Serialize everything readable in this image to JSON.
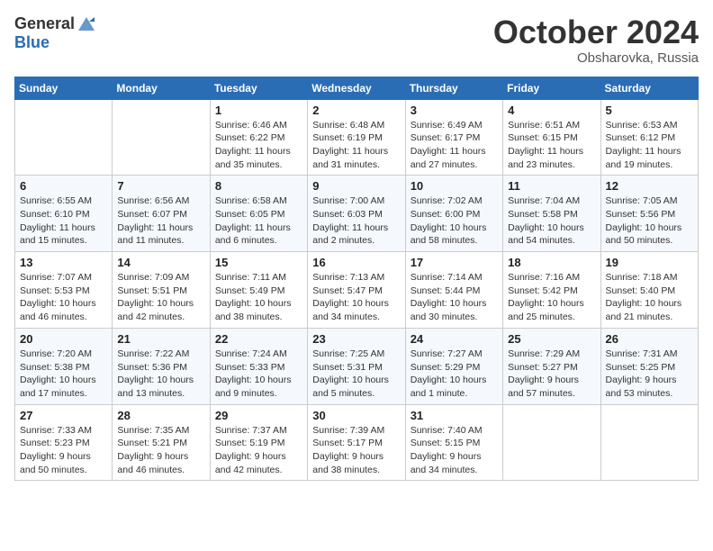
{
  "header": {
    "logo_general": "General",
    "logo_blue": "Blue",
    "month": "October 2024",
    "location": "Obsharovka, Russia"
  },
  "days_of_week": [
    "Sunday",
    "Monday",
    "Tuesday",
    "Wednesday",
    "Thursday",
    "Friday",
    "Saturday"
  ],
  "weeks": [
    [
      null,
      null,
      {
        "day": 1,
        "sunrise": "6:46 AM",
        "sunset": "6:22 PM",
        "daylight": "11 hours and 35 minutes."
      },
      {
        "day": 2,
        "sunrise": "6:48 AM",
        "sunset": "6:19 PM",
        "daylight": "11 hours and 31 minutes."
      },
      {
        "day": 3,
        "sunrise": "6:49 AM",
        "sunset": "6:17 PM",
        "daylight": "11 hours and 27 minutes."
      },
      {
        "day": 4,
        "sunrise": "6:51 AM",
        "sunset": "6:15 PM",
        "daylight": "11 hours and 23 minutes."
      },
      {
        "day": 5,
        "sunrise": "6:53 AM",
        "sunset": "6:12 PM",
        "daylight": "11 hours and 19 minutes."
      }
    ],
    [
      {
        "day": 6,
        "sunrise": "6:55 AM",
        "sunset": "6:10 PM",
        "daylight": "11 hours and 15 minutes."
      },
      {
        "day": 7,
        "sunrise": "6:56 AM",
        "sunset": "6:07 PM",
        "daylight": "11 hours and 11 minutes."
      },
      {
        "day": 8,
        "sunrise": "6:58 AM",
        "sunset": "6:05 PM",
        "daylight": "11 hours and 6 minutes."
      },
      {
        "day": 9,
        "sunrise": "7:00 AM",
        "sunset": "6:03 PM",
        "daylight": "11 hours and 2 minutes."
      },
      {
        "day": 10,
        "sunrise": "7:02 AM",
        "sunset": "6:00 PM",
        "daylight": "10 hours and 58 minutes."
      },
      {
        "day": 11,
        "sunrise": "7:04 AM",
        "sunset": "5:58 PM",
        "daylight": "10 hours and 54 minutes."
      },
      {
        "day": 12,
        "sunrise": "7:05 AM",
        "sunset": "5:56 PM",
        "daylight": "10 hours and 50 minutes."
      }
    ],
    [
      {
        "day": 13,
        "sunrise": "7:07 AM",
        "sunset": "5:53 PM",
        "daylight": "10 hours and 46 minutes."
      },
      {
        "day": 14,
        "sunrise": "7:09 AM",
        "sunset": "5:51 PM",
        "daylight": "10 hours and 42 minutes."
      },
      {
        "day": 15,
        "sunrise": "7:11 AM",
        "sunset": "5:49 PM",
        "daylight": "10 hours and 38 minutes."
      },
      {
        "day": 16,
        "sunrise": "7:13 AM",
        "sunset": "5:47 PM",
        "daylight": "10 hours and 34 minutes."
      },
      {
        "day": 17,
        "sunrise": "7:14 AM",
        "sunset": "5:44 PM",
        "daylight": "10 hours and 30 minutes."
      },
      {
        "day": 18,
        "sunrise": "7:16 AM",
        "sunset": "5:42 PM",
        "daylight": "10 hours and 25 minutes."
      },
      {
        "day": 19,
        "sunrise": "7:18 AM",
        "sunset": "5:40 PM",
        "daylight": "10 hours and 21 minutes."
      }
    ],
    [
      {
        "day": 20,
        "sunrise": "7:20 AM",
        "sunset": "5:38 PM",
        "daylight": "10 hours and 17 minutes."
      },
      {
        "day": 21,
        "sunrise": "7:22 AM",
        "sunset": "5:36 PM",
        "daylight": "10 hours and 13 minutes."
      },
      {
        "day": 22,
        "sunrise": "7:24 AM",
        "sunset": "5:33 PM",
        "daylight": "10 hours and 9 minutes."
      },
      {
        "day": 23,
        "sunrise": "7:25 AM",
        "sunset": "5:31 PM",
        "daylight": "10 hours and 5 minutes."
      },
      {
        "day": 24,
        "sunrise": "7:27 AM",
        "sunset": "5:29 PM",
        "daylight": "10 hours and 1 minute."
      },
      {
        "day": 25,
        "sunrise": "7:29 AM",
        "sunset": "5:27 PM",
        "daylight": "9 hours and 57 minutes."
      },
      {
        "day": 26,
        "sunrise": "7:31 AM",
        "sunset": "5:25 PM",
        "daylight": "9 hours and 53 minutes."
      }
    ],
    [
      {
        "day": 27,
        "sunrise": "7:33 AM",
        "sunset": "5:23 PM",
        "daylight": "9 hours and 50 minutes."
      },
      {
        "day": 28,
        "sunrise": "7:35 AM",
        "sunset": "5:21 PM",
        "daylight": "9 hours and 46 minutes."
      },
      {
        "day": 29,
        "sunrise": "7:37 AM",
        "sunset": "5:19 PM",
        "daylight": "9 hours and 42 minutes."
      },
      {
        "day": 30,
        "sunrise": "7:39 AM",
        "sunset": "5:17 PM",
        "daylight": "9 hours and 38 minutes."
      },
      {
        "day": 31,
        "sunrise": "7:40 AM",
        "sunset": "5:15 PM",
        "daylight": "9 hours and 34 minutes."
      },
      null,
      null
    ]
  ]
}
